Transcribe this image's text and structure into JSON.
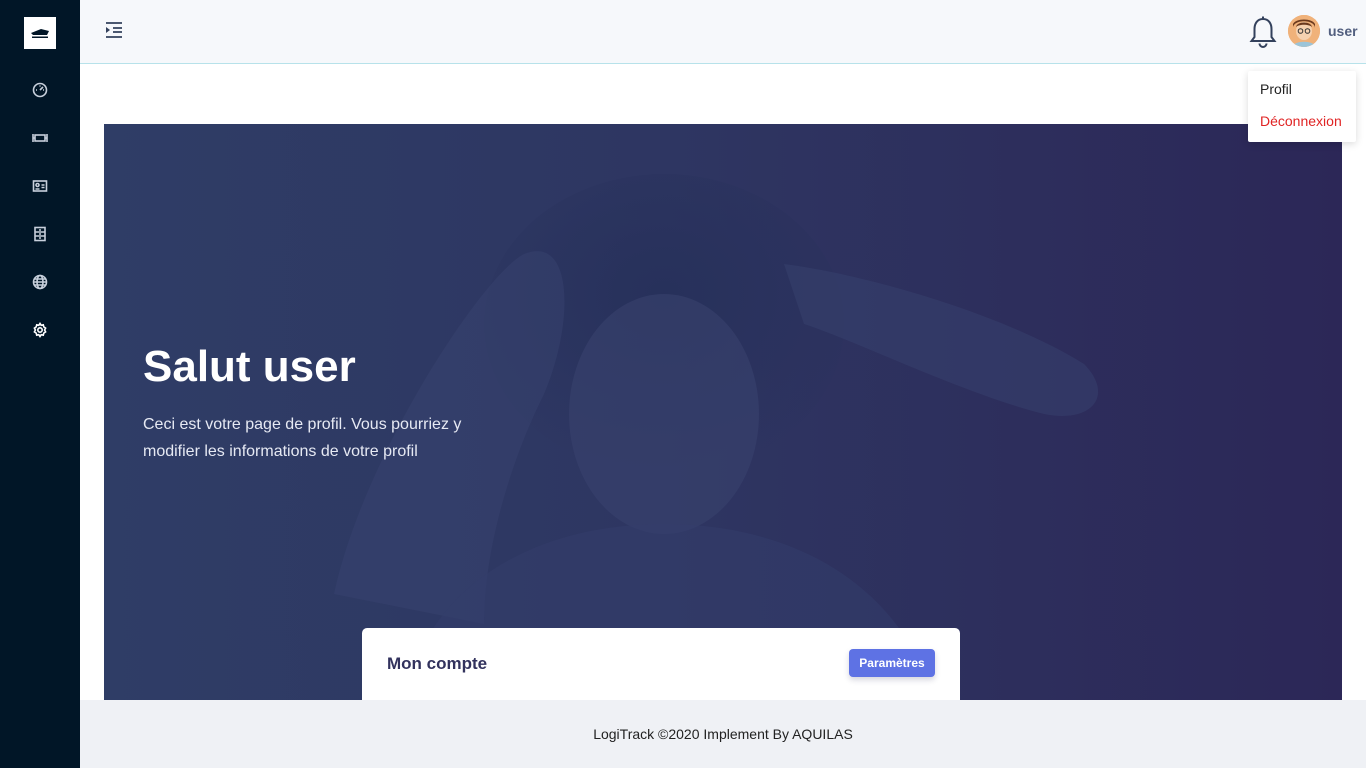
{
  "sidebar": {
    "logo_icon": "logitrack-logo",
    "items": [
      {
        "icon": "dashboard-icon"
      },
      {
        "icon": "truck-icon"
      },
      {
        "icon": "id-card-icon"
      },
      {
        "icon": "archive-icon"
      },
      {
        "icon": "globe-icon"
      },
      {
        "icon": "settings-icon"
      }
    ]
  },
  "topbar": {
    "username": "user",
    "dropdown": {
      "profile_label": "Profil",
      "logout_label": "Déconnexion"
    }
  },
  "hero": {
    "title": "Salut user",
    "description": "Ceci est votre page de profil. Vous pourriez y modifier les informations de votre profil"
  },
  "card": {
    "title": "Mon compte",
    "button_label": "Paramètres"
  },
  "footer": {
    "text": "LogiTrack ©2020 Implement By AQUILAS"
  },
  "colors": {
    "sidebar_bg": "#011627",
    "accent": "#5e72e4",
    "logout": "#e02424"
  }
}
